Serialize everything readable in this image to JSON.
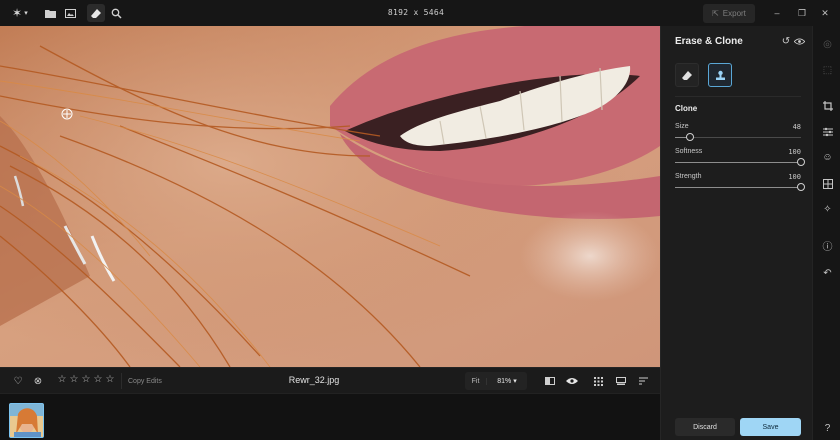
{
  "toolbar": {
    "app_menu_icon": "sparkle-icon",
    "tools": [
      {
        "name": "folder-icon"
      },
      {
        "name": "photo-icon"
      },
      {
        "name": "eraser-icon"
      },
      {
        "name": "zoom-icon"
      }
    ],
    "image_dimensions": "8192 x 5464",
    "export_label": "Export"
  },
  "bottom": {
    "filename": "Rewr_32.jpg",
    "copy_edits_label": "Copy Edits",
    "fit_label": "Fit",
    "zoom_value": "81%",
    "rating": 0,
    "rating_max": 5
  },
  "panel": {
    "title": "Erase & Clone",
    "section_title": "Clone",
    "sliders": [
      {
        "label": "Size",
        "value": "48",
        "fraction": 0.12
      },
      {
        "label": "Softness",
        "value": "100",
        "fraction": 1.0
      },
      {
        "label": "Strength",
        "value": "100",
        "fraction": 1.0
      }
    ],
    "discard_label": "Discard",
    "save_label": "Save"
  },
  "colors": {
    "accent": "#9fd6f5",
    "background": "#161616",
    "panel": "#1d1d1d"
  }
}
